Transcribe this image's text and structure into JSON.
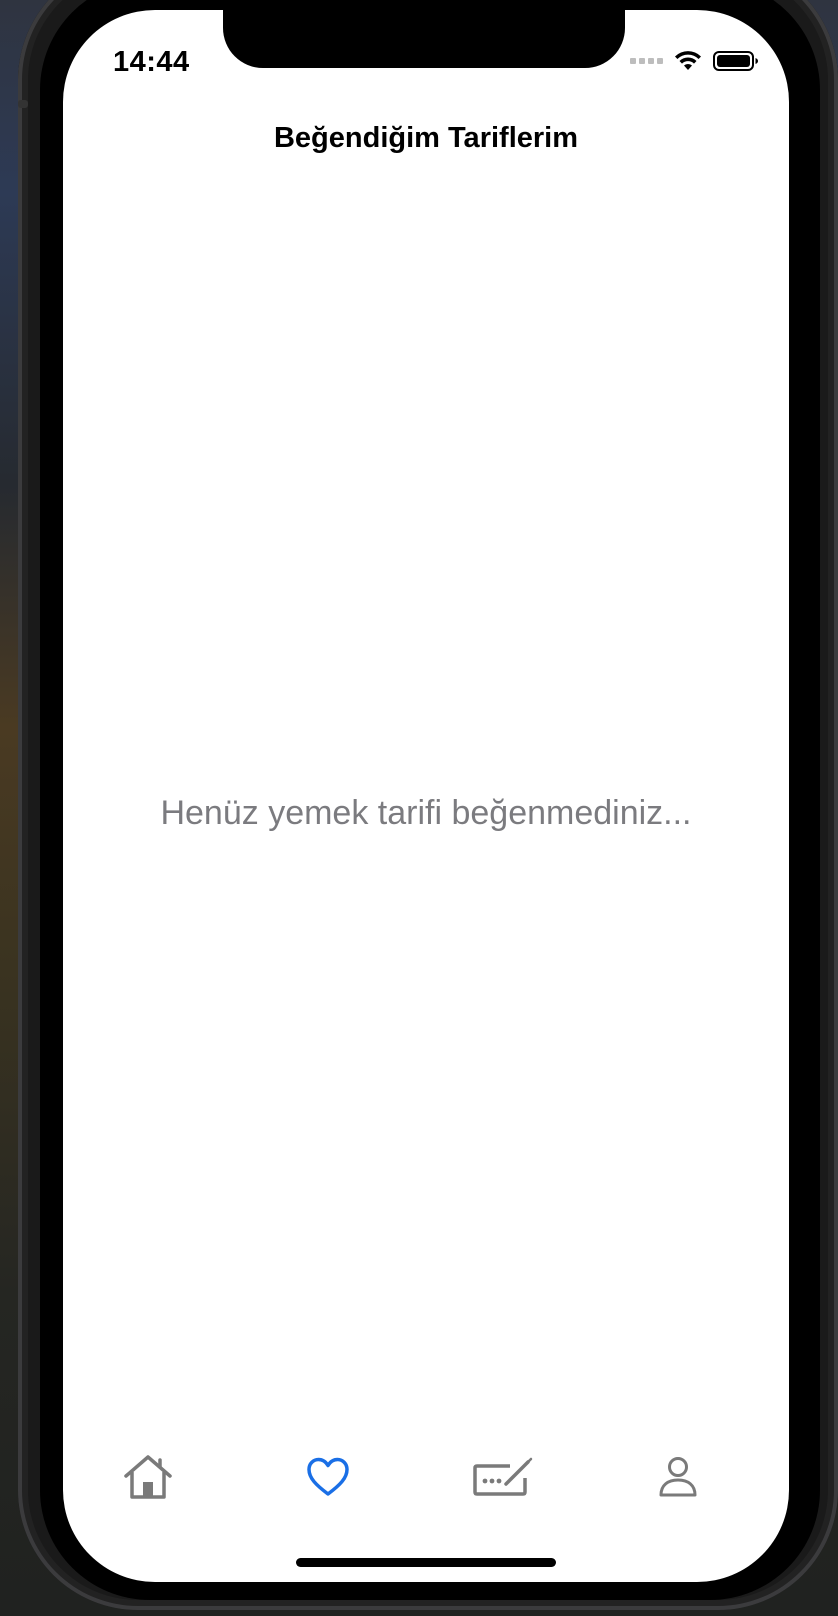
{
  "status_bar": {
    "time": "14:44"
  },
  "header": {
    "title": "Beğendiğim Tariflerim"
  },
  "main": {
    "empty_message": "Henüz yemek tarifi beğenmediniz..."
  },
  "tab_bar": {
    "tabs": [
      {
        "icon": "home-icon",
        "selected": false
      },
      {
        "icon": "heart-icon",
        "selected": true
      },
      {
        "icon": "signature-icon",
        "selected": false
      },
      {
        "icon": "person-icon",
        "selected": false
      }
    ],
    "active_color": "#1a6fe6",
    "inactive_color": "#7a7a7a"
  }
}
